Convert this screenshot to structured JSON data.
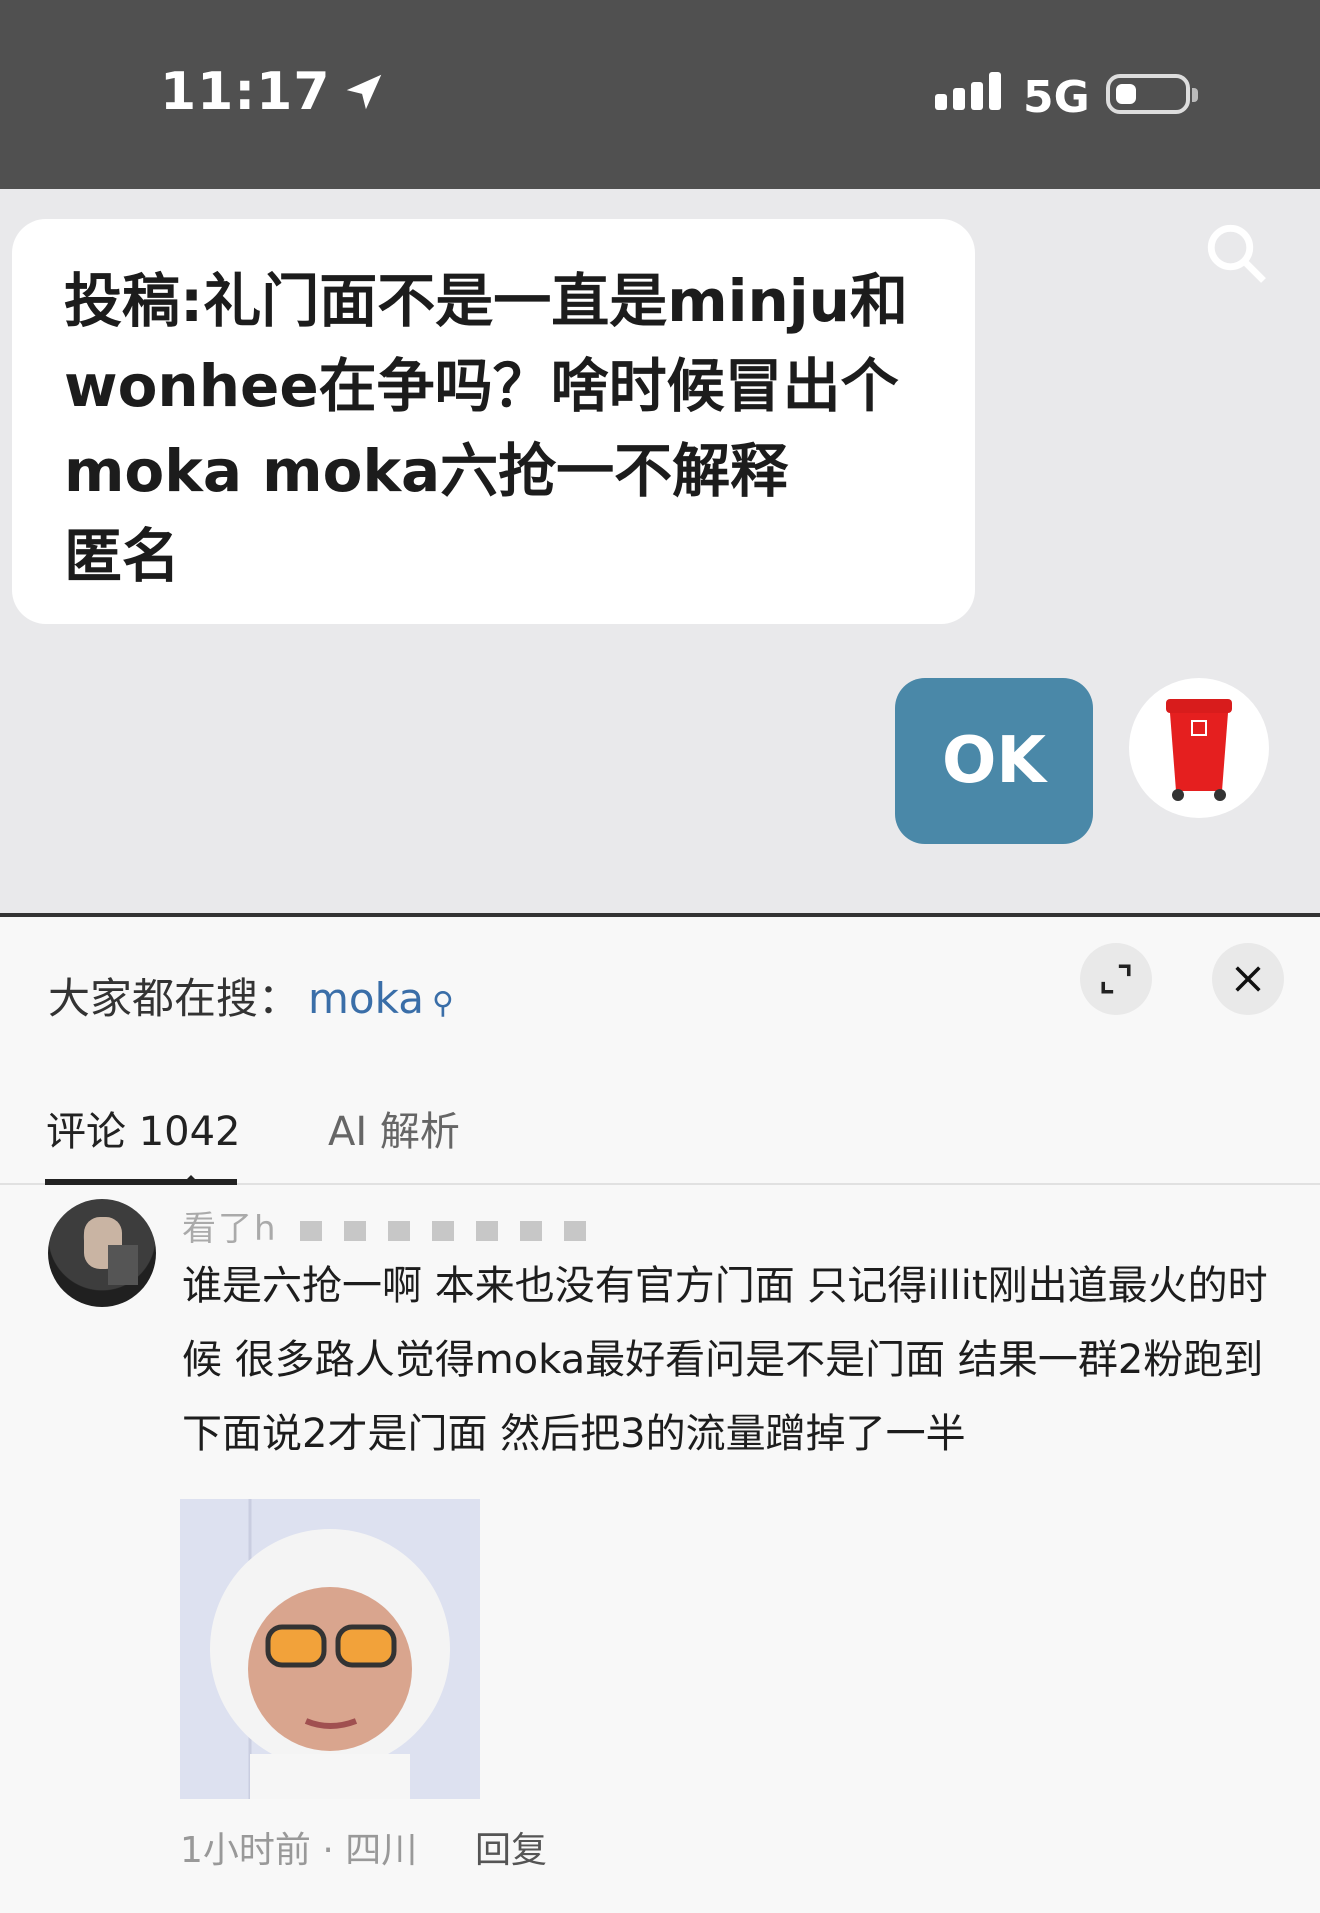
{
  "status_bar": {
    "time": "11:17",
    "network": "5G",
    "location_icon": "location-arrow-icon",
    "signal_icon": "signal-bars-icon",
    "battery_icon": "battery-low-icon"
  },
  "post": {
    "lines": [
      "投稿:礼门面不是一直是minju和",
      "wonhee在争吗？啥时候冒出个",
      "moka moka六抢一不解释",
      "匿名"
    ]
  },
  "actions": {
    "ok_label": "OK",
    "bin_icon": "red-trash-bin-icon",
    "search_icon": "search-icon"
  },
  "sheet": {
    "trending_prefix": "大家都在搜：",
    "trending_term": "moka",
    "expand_icon": "expand-icon",
    "close_icon": "close-icon"
  },
  "tabs": [
    {
      "label": "评论 1042",
      "active": true
    },
    {
      "label": "AI 解析",
      "active": false
    }
  ],
  "comment": {
    "username": "看了h",
    "text": "谁是六抢一啊 本来也没有官方门面 只记得illit刚出道最火的时候 很多路人觉得moka最好看问是不是门面 结果一群2粉跑到下面说2才是门面 然后把3的流量蹭掉了一半",
    "meta": "1小时前 · 四川",
    "reply_label": "回复"
  },
  "colors": {
    "accent": "#4a88a8",
    "status_bg": "#505050",
    "post_bg": "#e9e9eb"
  }
}
